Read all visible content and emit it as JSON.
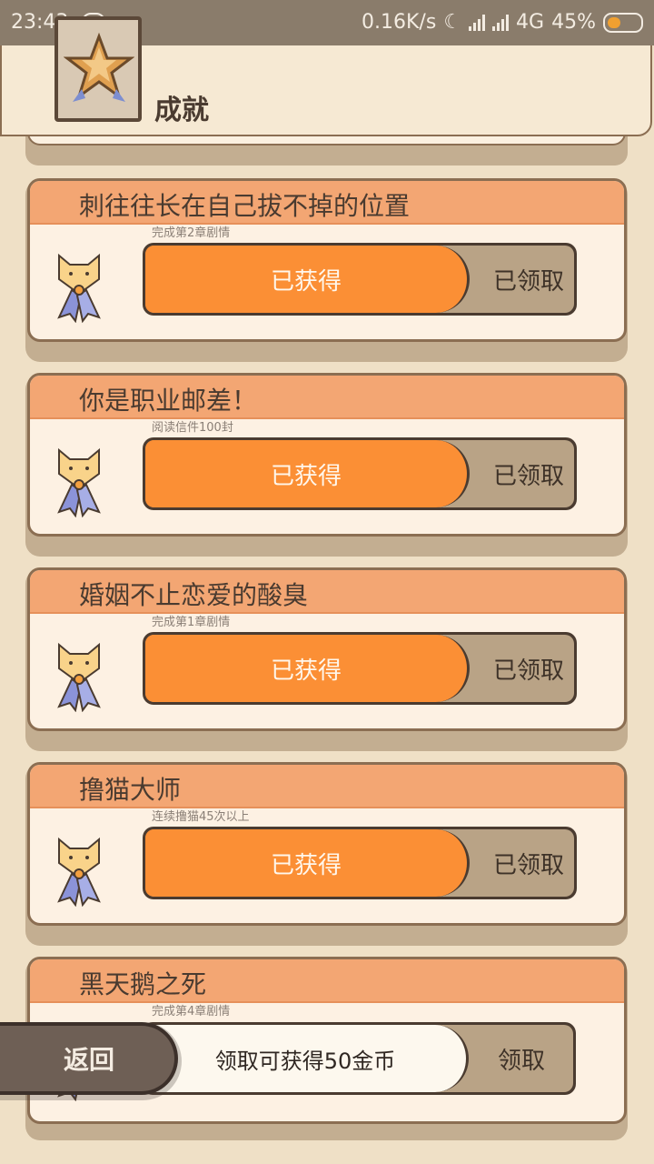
{
  "status_bar": {
    "time": "23:43",
    "speed": "0.16K/s",
    "network": "4G",
    "battery": "45%"
  },
  "header": {
    "title": "成就",
    "icon": "star-badge-icon"
  },
  "achievements": [
    {
      "title": "刺往往长在自己拔不掉的位置",
      "subtitle": "完成第2章剧情",
      "status_label": "已获得",
      "action_label": "已领取",
      "icon": "cat-medal-icon"
    },
    {
      "title": "你是职业邮差！",
      "subtitle": "阅读信件100封",
      "status_label": "已获得",
      "action_label": "已领取",
      "icon": "cat-medal-icon"
    },
    {
      "title": "婚姻不止恋爱的酸臭",
      "subtitle": "完成第1章剧情",
      "status_label": "已获得",
      "action_label": "已领取",
      "icon": "cat-medal-icon"
    },
    {
      "title": "撸猫大师",
      "subtitle": "连续撸猫45次以上",
      "status_label": "已获得",
      "action_label": "已领取",
      "icon": "cat-medal-icon"
    },
    {
      "title": "黑天鹅之死",
      "subtitle": "完成第4章剧情",
      "icon": "cat-medal-icon"
    }
  ],
  "claim_bar": {
    "info": "领取可获得50金币",
    "action_label": "领取"
  },
  "back_button": {
    "label": "返回"
  },
  "colors": {
    "accent": "#fb8f35",
    "card_header": "#f3a673",
    "background": "#efe0c6",
    "dark": "#4a3b30"
  }
}
